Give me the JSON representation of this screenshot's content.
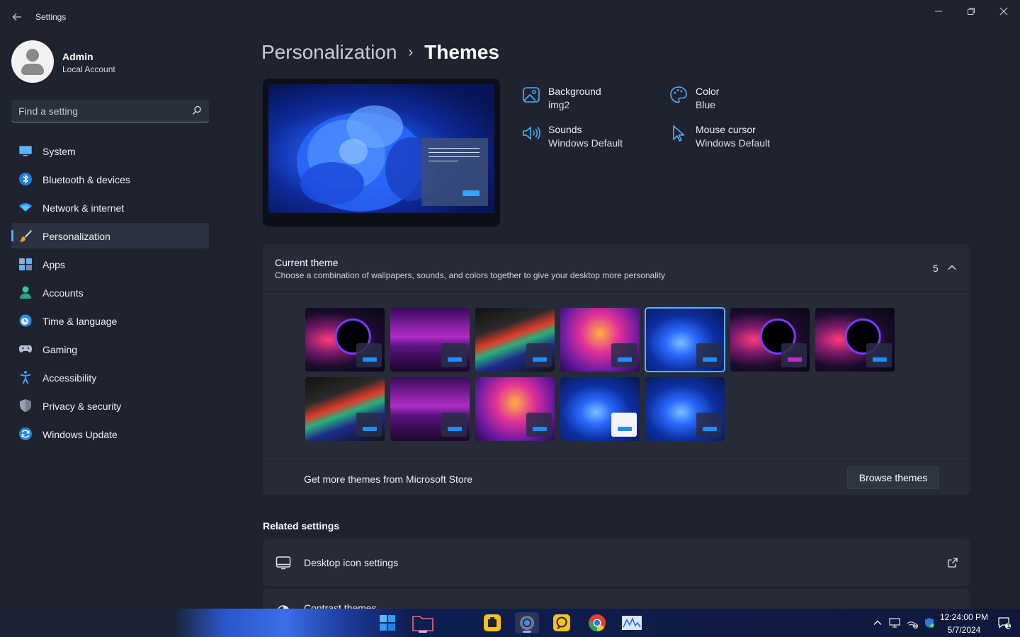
{
  "app": {
    "title": "Settings"
  },
  "user": {
    "name": "Admin",
    "account_type": "Local Account"
  },
  "search": {
    "placeholder": "Find a setting"
  },
  "sidebar": {
    "items": [
      {
        "label": "System",
        "icon": "monitor-icon"
      },
      {
        "label": "Bluetooth & devices",
        "icon": "bluetooth-icon"
      },
      {
        "label": "Network & internet",
        "icon": "wifi-icon"
      },
      {
        "label": "Personalization",
        "icon": "brush-icon",
        "active": true
      },
      {
        "label": "Apps",
        "icon": "apps-icon"
      },
      {
        "label": "Accounts",
        "icon": "person-icon"
      },
      {
        "label": "Time & language",
        "icon": "globe-clock-icon"
      },
      {
        "label": "Gaming",
        "icon": "gamepad-icon"
      },
      {
        "label": "Accessibility",
        "icon": "accessibility-icon"
      },
      {
        "label": "Privacy & security",
        "icon": "shield-icon"
      },
      {
        "label": "Windows Update",
        "icon": "update-icon"
      }
    ]
  },
  "breadcrumb": {
    "parent": "Personalization",
    "separator": "›",
    "current": "Themes"
  },
  "theme_properties": {
    "background": {
      "label": "Background",
      "value": "img2",
      "icon": "image-icon"
    },
    "color": {
      "label": "Color",
      "value": "Blue",
      "icon": "palette-icon"
    },
    "sounds": {
      "label": "Sounds",
      "value": "Windows Default",
      "icon": "speaker-icon"
    },
    "cursor": {
      "label": "Mouse cursor",
      "value": "Windows Default",
      "icon": "cursor-icon"
    }
  },
  "current_theme": {
    "title": "Current theme",
    "description": "Choose a combination of wallpapers, sounds, and colors together to give your desktop more personality",
    "count": "5",
    "themes": [
      {
        "style": "galaxy",
        "accent": "#1f8cff"
      },
      {
        "style": "city",
        "accent": "#1f8cff"
      },
      {
        "style": "glow",
        "accent": "#1f8cff"
      },
      {
        "style": "fox",
        "accent": "#1f8cff"
      },
      {
        "style": "bloom",
        "accent": "#1f8cff",
        "selected": true
      },
      {
        "style": "galaxy",
        "accent": "#c02ac8"
      },
      {
        "style": "galaxy",
        "accent": "#1f8cff"
      },
      {
        "style": "glow",
        "accent": "#1f8cff"
      },
      {
        "style": "city",
        "accent": "#1f8cff"
      },
      {
        "style": "fox",
        "accent": "#1f8cff"
      },
      {
        "style": "bloom",
        "accent": "#1f8cff",
        "light": true
      },
      {
        "style": "bloom",
        "accent": "#1f8cff"
      }
    ],
    "store_label": "Get more themes from Microsoft Store",
    "browse_button": "Browse themes"
  },
  "related_settings": {
    "title": "Related settings",
    "items": [
      {
        "label": "Desktop icon settings",
        "icon": "desktop-icon"
      },
      {
        "label": "Contrast themes",
        "icon": "contrast-icon"
      }
    ]
  },
  "taskbar": {
    "apps": [
      "start-icon",
      "file-explorer-icon",
      "app-yellow-icon",
      "settings-icon",
      "app-chat-icon",
      "chrome-icon",
      "monitor-app-icon"
    ],
    "time": "12:24:00 PM",
    "date": "5/7/2024",
    "notification_count": "1"
  },
  "colors": {
    "accent": "#5aa9ff",
    "background": "#1f2330",
    "card": "#262b37"
  }
}
